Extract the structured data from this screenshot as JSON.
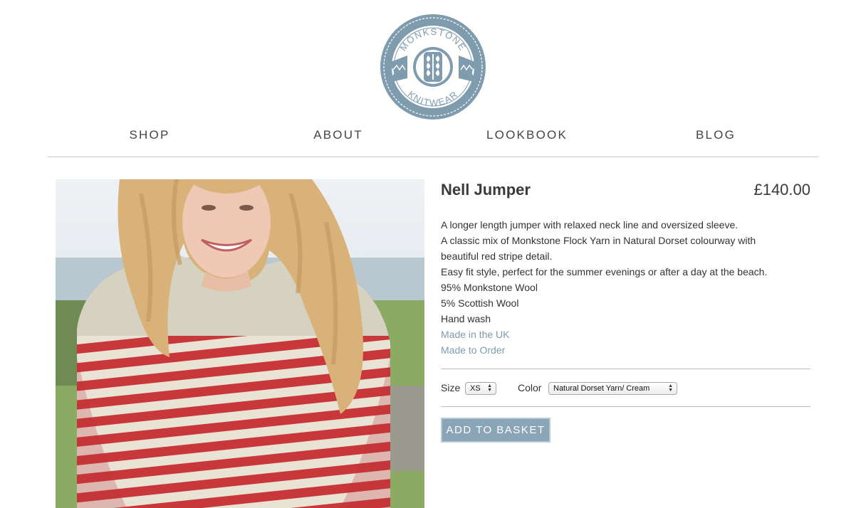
{
  "brand": {
    "top_text": "MONKSTONE",
    "bottom_text": "KNITWEAR",
    "color": "#7f9cae"
  },
  "nav": {
    "items": [
      {
        "label": "SHOP"
      },
      {
        "label": "ABOUT"
      },
      {
        "label": "LOOKBOOK"
      },
      {
        "label": "BLOG"
      }
    ]
  },
  "product": {
    "name": "Nell Jumper",
    "price": "£140.00",
    "description": [
      "A longer length jumper with relaxed neck line and oversized sleeve.",
      "A classic mix of Monkstone Flock Yarn in Natural Dorset colourway with",
      "beautiful red stripe detail.",
      "Easy fit style, perfect for the summer evenings or after a day at the beach.",
      "95% Monkstone Wool",
      "5% Scottish Wool",
      "Hand wash"
    ],
    "links": [
      {
        "label": "Made in the UK"
      },
      {
        "label": "Made to Order"
      }
    ],
    "size_label": "Size",
    "size_value": "XS",
    "color_label": "Color",
    "color_value": "Natural Dorset Yarn/ Cream",
    "add_button": "ADD TO BASKET",
    "link_color": "#7e9bb0",
    "button_color": "#8aa5b8",
    "stripe_color": "#c8383a"
  }
}
